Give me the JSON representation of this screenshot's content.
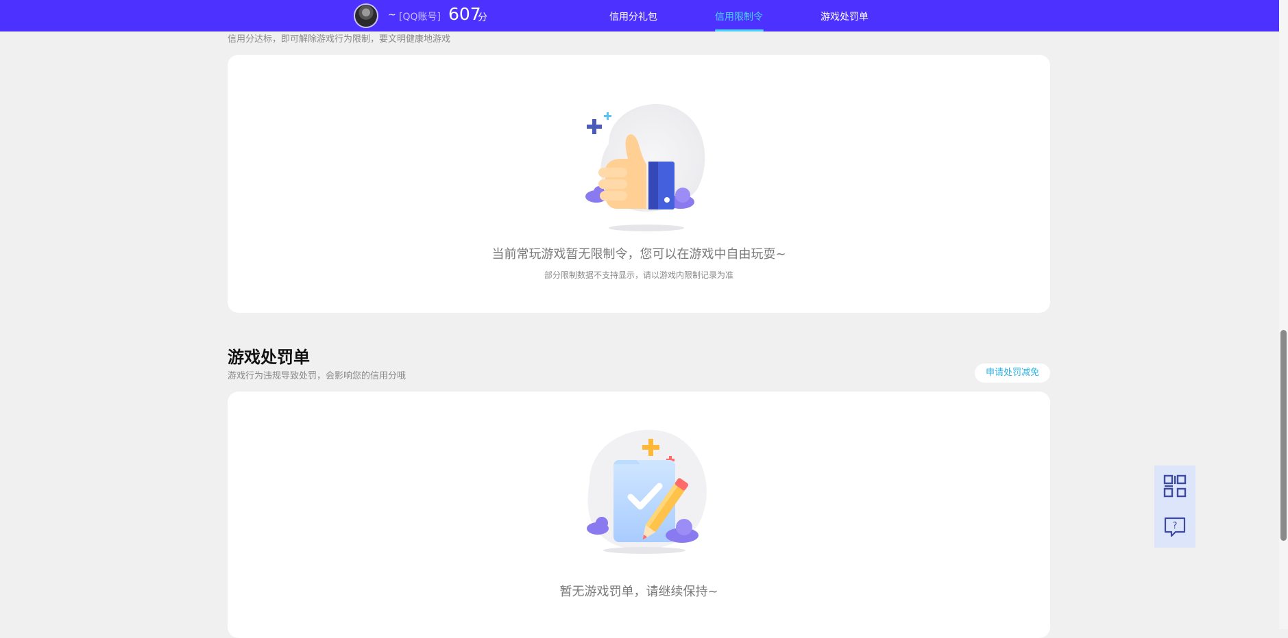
{
  "header": {
    "user_name": "~",
    "account_label": "[QQ账号]",
    "score": "607",
    "score_unit": "分",
    "tabs": [
      {
        "label": "信用分礼包",
        "active": false
      },
      {
        "label": "信用限制令",
        "active": true
      },
      {
        "label": "游戏处罚单",
        "active": false
      }
    ],
    "accent_color": "#4d32ff",
    "active_tab_color": "#49d3ff"
  },
  "restriction_section": {
    "description": "信用分达标，即可解除游戏行为限制，要文明健康地游戏",
    "empty_message": "当前常玩游戏暂无限制令，您可以在游戏中自由玩耍~",
    "empty_note": "部分限制数据不支持显示，请以游戏内限制记录为准",
    "illustration_icon": "thumbs-up-icon"
  },
  "penalty_section": {
    "title": "游戏处罚单",
    "description": "游戏行为违规导致处罚，会影响您的信用分哦",
    "apply_button": "申请处罚减免",
    "empty_message": "暂无游戏罚单，请继续保持~",
    "illustration_icon": "clipboard-check-icon"
  },
  "floating_buttons": [
    {
      "icon": "qr-code-icon"
    },
    {
      "icon": "help-chat-icon"
    }
  ]
}
